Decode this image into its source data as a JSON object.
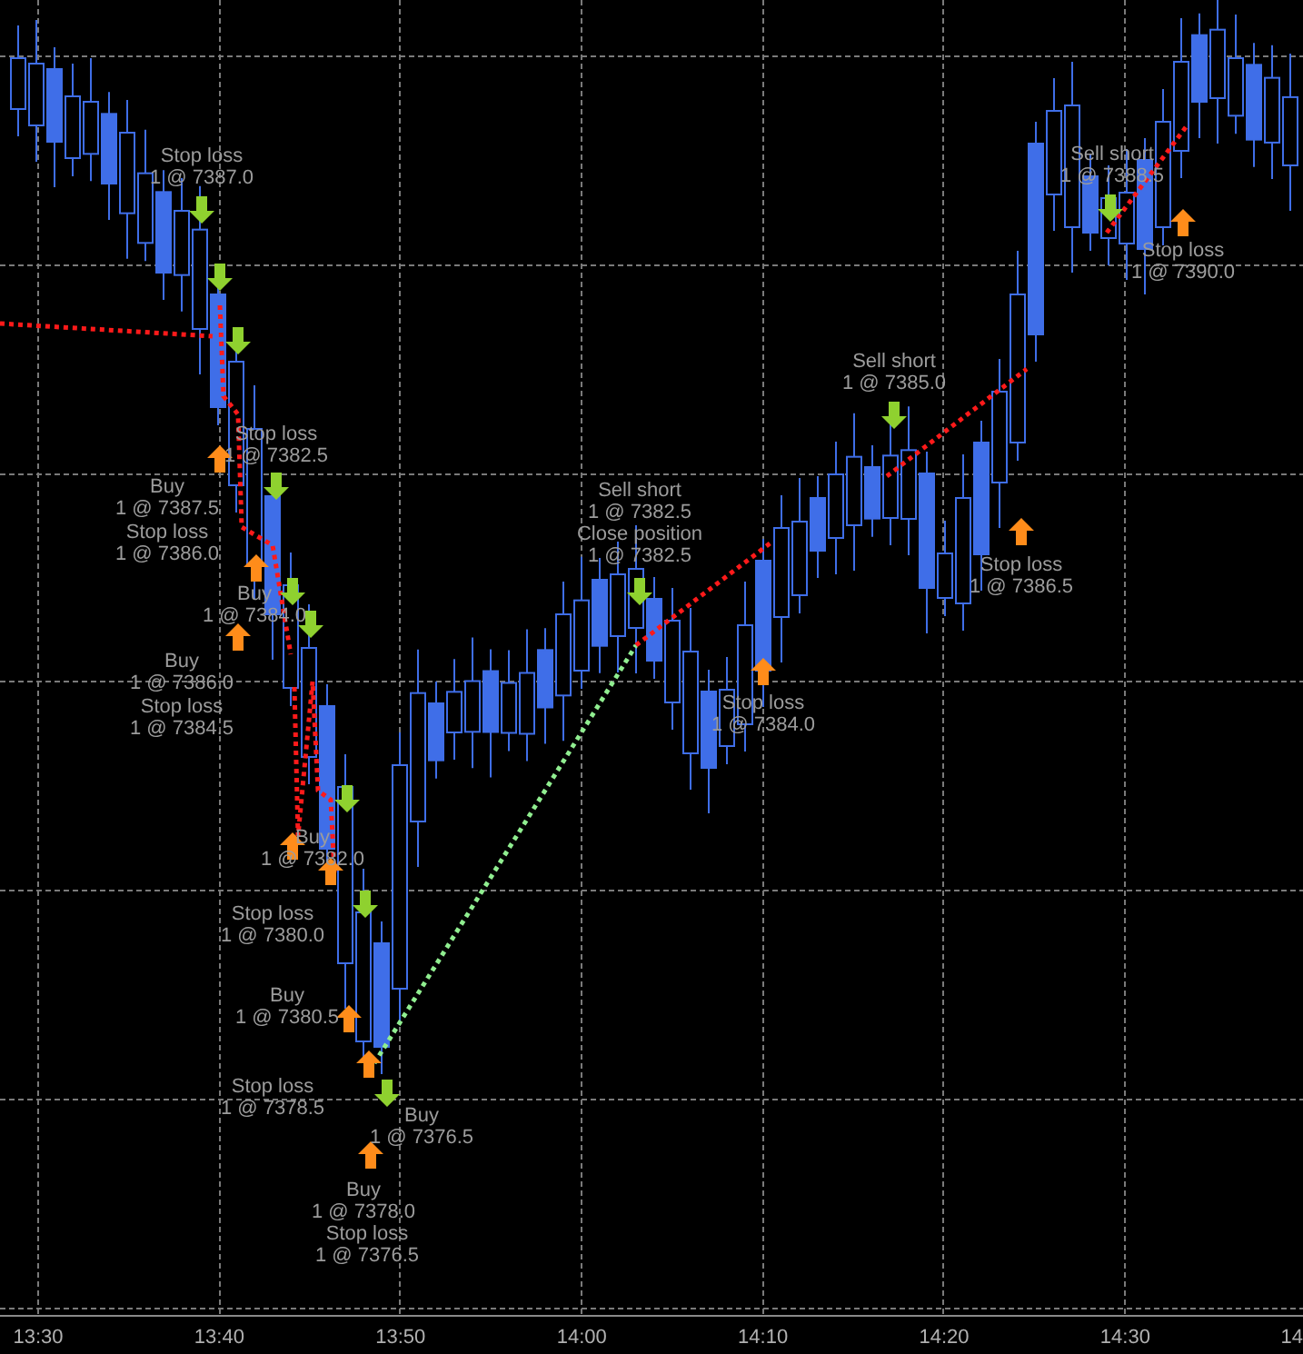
{
  "annotations": [
    {
      "lines": [
        "Stop loss",
        "1 @ 7387.0"
      ]
    },
    {
      "lines": [
        "Stop loss",
        "1 @ 7382.5"
      ]
    },
    {
      "lines": [
        "Buy",
        "1 @ 7387.5"
      ]
    },
    {
      "lines": [
        "Stop loss",
        "1 @ 7386.0"
      ]
    },
    {
      "lines": [
        "Buy",
        "1 @ 7384.0"
      ]
    },
    {
      "lines": [
        "Buy",
        "1 @ 7386.0"
      ]
    },
    {
      "lines": [
        "Stop loss",
        "1 @ 7384.5"
      ]
    },
    {
      "lines": [
        "Buy",
        "1 @ 7382.0"
      ]
    },
    {
      "lines": [
        "Stop loss",
        "1 @ 7380.0"
      ]
    },
    {
      "lines": [
        "Buy",
        "1 @ 7380.5"
      ]
    },
    {
      "lines": [
        "Stop loss",
        "1 @ 7378.5"
      ]
    },
    {
      "lines": [
        "Buy",
        "1 @ 7376.5"
      ]
    },
    {
      "lines": [
        "Buy",
        "1 @ 7378.0"
      ]
    },
    {
      "lines": [
        "Stop loss",
        "1 @ 7376.5"
      ]
    },
    {
      "lines": [
        "Sell short",
        "1 @ 7382.5",
        "Close position",
        "1 @ 7382.5"
      ]
    },
    {
      "lines": [
        "Stop loss",
        "1 @ 7384.0"
      ]
    },
    {
      "lines": [
        "Sell short",
        "1 @ 7385.0"
      ]
    },
    {
      "lines": [
        "Stop loss",
        "1 @ 7386.5"
      ]
    },
    {
      "lines": [
        "Sell short",
        "1 @ 7388.5"
      ]
    },
    {
      "lines": [
        "Stop loss",
        "1 @ 7390.0"
      ]
    }
  ],
  "time_axis": {
    "ticks": [
      "13:30",
      "13:40",
      "13:50",
      "14:00",
      "14:10",
      "14:20",
      "14:30",
      "14"
    ]
  }
}
